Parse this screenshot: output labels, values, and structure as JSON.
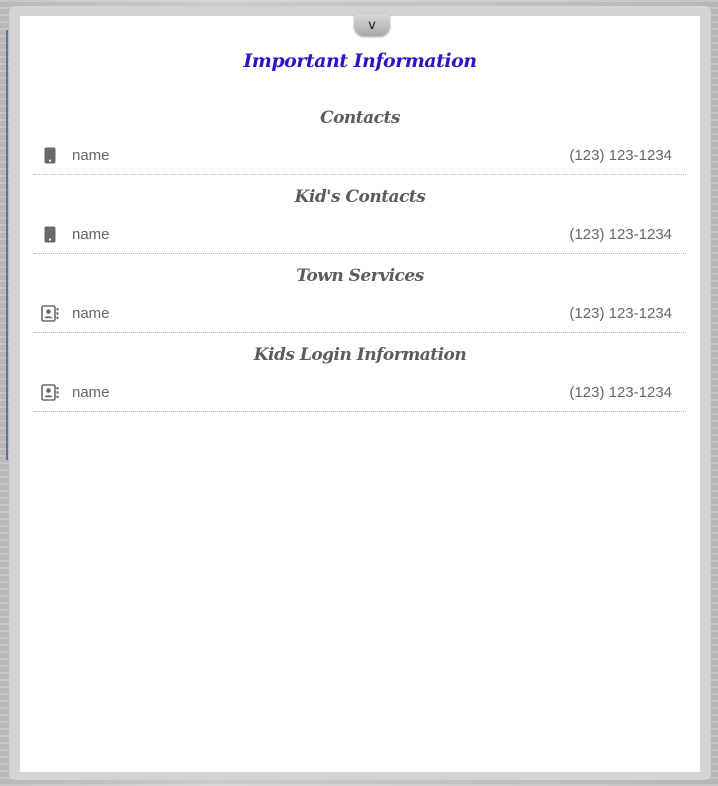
{
  "handle": {
    "label": "v"
  },
  "title": "Important Information",
  "colors": {
    "title": "#2a16c4",
    "heading": "#5c5c5c",
    "text": "#666666",
    "icon": "#6a6a6a"
  },
  "sections": [
    {
      "heading": "Contacts",
      "rows": [
        {
          "icon": "phone-icon",
          "name": "name",
          "phone": "(123) 123-1234"
        }
      ]
    },
    {
      "heading": "Kid's Contacts",
      "rows": [
        {
          "icon": "phone-icon",
          "name": "name",
          "phone": "(123) 123-1234"
        }
      ]
    },
    {
      "heading": "Town Services",
      "rows": [
        {
          "icon": "contact-card-icon",
          "name": "name",
          "phone": "(123) 123-1234"
        }
      ]
    },
    {
      "heading": "Kids Login Information",
      "rows": [
        {
          "icon": "contact-card-icon",
          "name": "name",
          "phone": "(123) 123-1234"
        }
      ]
    }
  ]
}
